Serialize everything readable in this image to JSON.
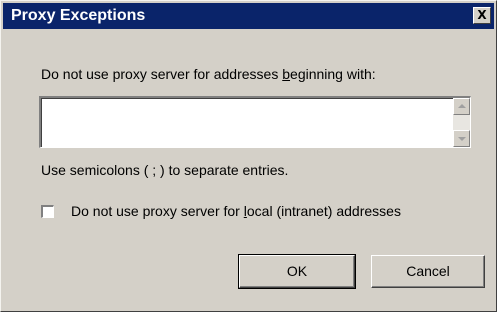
{
  "window": {
    "title": "Proxy Exceptions",
    "close_glyph": "X",
    "title_bar_color": "#0a246a",
    "face_color": "#d4d0c8"
  },
  "prompt": {
    "before": "Do not use proxy server for addresses ",
    "accel": "b",
    "after": "eginning with:"
  },
  "exceptions_field": {
    "value": ""
  },
  "hint": "Use semicolons ( ; ) to separate entries.",
  "local_checkbox": {
    "checked": false,
    "label_before": "Do not use proxy server for ",
    "accel": "l",
    "label_after": "ocal (intranet) addresses"
  },
  "buttons": {
    "ok": "OK",
    "cancel": "Cancel"
  }
}
